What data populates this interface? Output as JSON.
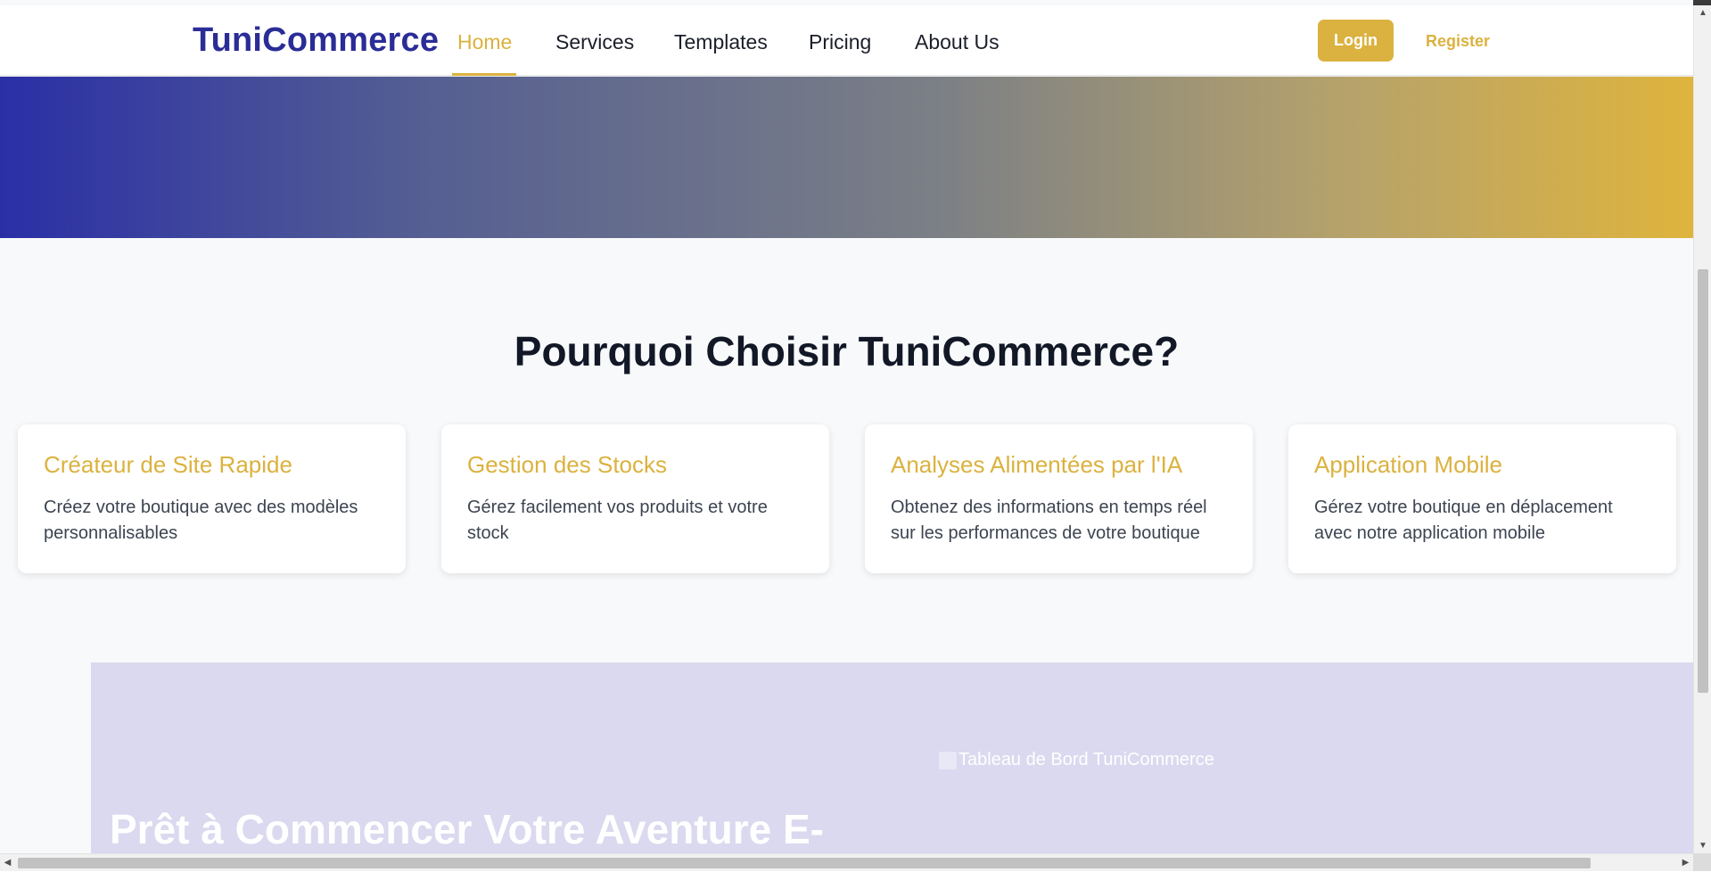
{
  "navbar": {
    "brand": "TuniCommerce",
    "links": [
      {
        "label": "Home",
        "active": true
      },
      {
        "label": "Services"
      },
      {
        "label": "Templates"
      },
      {
        "label": "Pricing"
      },
      {
        "label": "About Us"
      }
    ],
    "login_label": "Login",
    "register_label": "Register"
  },
  "features": {
    "title": "Pourquoi Choisir TuniCommerce?",
    "cards": [
      {
        "title": "Créateur de Site Rapide",
        "text": "Créez votre boutique avec des modèles personnalisables"
      },
      {
        "title": "Gestion des Stocks",
        "text": "Gérez facilement vos produits et votre stock"
      },
      {
        "title": "Analyses Alimentées par l'IA",
        "text": "Obtenez des informations en temps réel sur les performances de votre boutique"
      },
      {
        "title": "Application Mobile",
        "text": "Gérez votre boutique en déplacement avec notre application mobile"
      }
    ]
  },
  "cta": {
    "title": "Prêt à Commencer Votre Aventure E-",
    "image_alt": "Tableau de Bord TuniCommerce"
  },
  "colors": {
    "brand": "#2a2d96",
    "accent": "#dbb23f",
    "cta_bg": "#dad9ef"
  }
}
